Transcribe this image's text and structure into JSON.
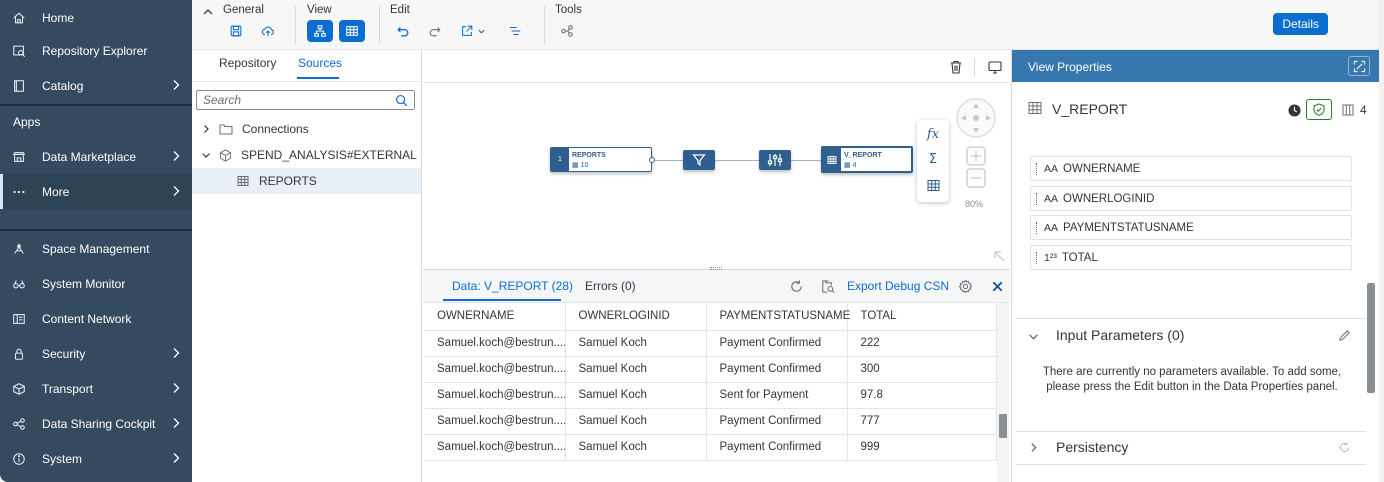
{
  "nav": {
    "items": [
      {
        "label": "Home",
        "icon": "home-icon",
        "chevron": false
      },
      {
        "label": "Repository Explorer",
        "icon": "repository-explorer-icon",
        "chevron": false
      },
      {
        "label": "Catalog",
        "icon": "catalog-icon",
        "chevron": true
      }
    ],
    "apps_label": "Apps",
    "apps_items": [
      {
        "label": "Data Marketplace",
        "icon": "marketplace-icon",
        "chevron": true
      },
      {
        "label": "More",
        "icon": "more-icon",
        "chevron": true,
        "active": true
      }
    ],
    "admin_items": [
      {
        "label": "Space Management",
        "icon": "space-management-icon",
        "chevron": false
      },
      {
        "label": "System Monitor",
        "icon": "system-monitor-icon",
        "chevron": false
      },
      {
        "label": "Content Network",
        "icon": "content-network-icon",
        "chevron": false
      },
      {
        "label": "Security",
        "icon": "security-icon",
        "chevron": true
      },
      {
        "label": "Transport",
        "icon": "transport-icon",
        "chevron": true
      },
      {
        "label": "Data Sharing Cockpit",
        "icon": "data-sharing-icon",
        "chevron": true
      },
      {
        "label": "System",
        "icon": "system-info-icon",
        "chevron": true
      }
    ]
  },
  "toolbar": {
    "general_label": "General",
    "view_label": "View",
    "edit_label": "Edit",
    "tools_label": "Tools",
    "details_label": "Details"
  },
  "repo": {
    "tab_repository": "Repository",
    "tab_sources": "Sources",
    "search_placeholder": "Search",
    "tree": {
      "connections": "Connections",
      "space": "SPEND_ANALYSIS#EXTERNAL",
      "reports": "REPORTS"
    }
  },
  "canvas": {
    "source_node": {
      "index": "1",
      "name": "REPORTS",
      "count": "10"
    },
    "output_node": {
      "name": "V_REPORT",
      "count": "4"
    },
    "zoom": "80%",
    "tools": {
      "function": "fx",
      "sum": "Σ"
    }
  },
  "data_preview": {
    "tab_data": "Data: V_REPORT (28)",
    "tab_errors": "Errors (0)",
    "export_label": "Export Debug CSN",
    "columns": [
      "OWNERNAME",
      "OWNERLOGINID",
      "PAYMENTSTATUSNAME",
      "TOTAL"
    ],
    "rows": [
      [
        "Samuel.koch@bestrun....",
        "Samuel Koch",
        "Payment Confirmed",
        "222"
      ],
      [
        "Samuel.koch@bestrun....",
        "Samuel Koch",
        "Payment Confirmed",
        "300"
      ],
      [
        "Samuel.koch@bestrun....",
        "Samuel Koch",
        "Sent for Payment",
        "97.8"
      ],
      [
        "Samuel.koch@bestrun....",
        "Samuel Koch",
        "Payment Confirmed",
        "777"
      ],
      [
        "Samuel.koch@bestrun....",
        "Samuel Koch",
        "Payment Confirmed",
        "999"
      ]
    ]
  },
  "props": {
    "title": "View Properties",
    "view_name": "V_REPORT",
    "column_count": "4",
    "columns": [
      {
        "type": "AA",
        "name": "OWNERNAME"
      },
      {
        "type": "AA",
        "name": "OWNERLOGINID"
      },
      {
        "type": "AA",
        "name": "PAYMENTSTATUSNAME"
      },
      {
        "type": "1²³",
        "name": "TOTAL"
      }
    ],
    "input_params_title": "Input Parameters (0)",
    "input_params_message": "There are currently no parameters available. To add some, please press the Edit button in the Data Properties panel.",
    "persistency_title": "Persistency"
  },
  "colors": {
    "nav_bg": "#354a5f",
    "accent": "#0a6ed1",
    "node_blue": "#2f5f8e",
    "props_header": "#3777b0"
  }
}
